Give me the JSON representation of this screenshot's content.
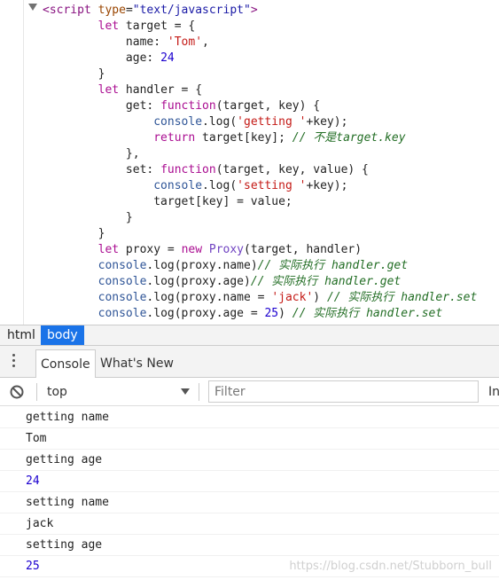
{
  "source": {
    "lines": [
      [
        {
          "t": "<",
          "c": "tag"
        },
        {
          "t": "script",
          "c": "tag"
        },
        {
          "t": " ",
          "c": "plain"
        },
        {
          "t": "type",
          "c": "attr"
        },
        {
          "t": "=",
          "c": "plain"
        },
        {
          "t": "\"text/javascript\"",
          "c": "aval"
        },
        {
          "t": ">",
          "c": "tag"
        }
      ],
      [
        {
          "t": "        ",
          "c": "plain"
        },
        {
          "t": "let",
          "c": "kw"
        },
        {
          "t": " target = {",
          "c": "plain"
        }
      ],
      [
        {
          "t": "            name: ",
          "c": "plain"
        },
        {
          "t": "'Tom'",
          "c": "str"
        },
        {
          "t": ",",
          "c": "plain"
        }
      ],
      [
        {
          "t": "            age: ",
          "c": "plain"
        },
        {
          "t": "24",
          "c": "num"
        }
      ],
      [
        {
          "t": "        }",
          "c": "plain"
        }
      ],
      [
        {
          "t": "        ",
          "c": "plain"
        },
        {
          "t": "let",
          "c": "kw"
        },
        {
          "t": " handler = {",
          "c": "plain"
        }
      ],
      [
        {
          "t": "            get: ",
          "c": "plain"
        },
        {
          "t": "function",
          "c": "kw"
        },
        {
          "t": "(target, key) {",
          "c": "plain"
        }
      ],
      [
        {
          "t": "                ",
          "c": "plain"
        },
        {
          "t": "console",
          "c": "fn"
        },
        {
          "t": ".log(",
          "c": "plain"
        },
        {
          "t": "'getting '",
          "c": "str"
        },
        {
          "t": "+key);",
          "c": "plain"
        }
      ],
      [
        {
          "t": "                ",
          "c": "plain"
        },
        {
          "t": "return",
          "c": "kw"
        },
        {
          "t": " target[key]; ",
          "c": "plain"
        },
        {
          "t": "// 不是target.key",
          "c": "cmt"
        }
      ],
      [
        {
          "t": "            },",
          "c": "plain"
        }
      ],
      [
        {
          "t": "            set: ",
          "c": "plain"
        },
        {
          "t": "function",
          "c": "kw"
        },
        {
          "t": "(target, key, value) {",
          "c": "plain"
        }
      ],
      [
        {
          "t": "                ",
          "c": "plain"
        },
        {
          "t": "console",
          "c": "fn"
        },
        {
          "t": ".log(",
          "c": "plain"
        },
        {
          "t": "'setting '",
          "c": "str"
        },
        {
          "t": "+key);",
          "c": "plain"
        }
      ],
      [
        {
          "t": "                target[key] = value;",
          "c": "plain"
        }
      ],
      [
        {
          "t": "            }",
          "c": "plain"
        }
      ],
      [
        {
          "t": "        }",
          "c": "plain"
        }
      ],
      [
        {
          "t": "        ",
          "c": "plain"
        },
        {
          "t": "let",
          "c": "kw"
        },
        {
          "t": " proxy = ",
          "c": "plain"
        },
        {
          "t": "new",
          "c": "kw"
        },
        {
          "t": " ",
          "c": "plain"
        },
        {
          "t": "Proxy",
          "c": "cls"
        },
        {
          "t": "(target, handler)",
          "c": "plain"
        }
      ],
      [
        {
          "t": "        ",
          "c": "plain"
        },
        {
          "t": "console",
          "c": "fn"
        },
        {
          "t": ".log(proxy.name)",
          "c": "plain"
        },
        {
          "t": "// 实际执行 handler.get",
          "c": "cmt"
        }
      ],
      [
        {
          "t": "        ",
          "c": "plain"
        },
        {
          "t": "console",
          "c": "fn"
        },
        {
          "t": ".log(proxy.age)",
          "c": "plain"
        },
        {
          "t": "// 实际执行 handler.get",
          "c": "cmt"
        }
      ],
      [
        {
          "t": "        ",
          "c": "plain"
        },
        {
          "t": "console",
          "c": "fn"
        },
        {
          "t": ".log(proxy.name = ",
          "c": "plain"
        },
        {
          "t": "'jack'",
          "c": "str"
        },
        {
          "t": ") ",
          "c": "plain"
        },
        {
          "t": "// 实际执行 handler.set",
          "c": "cmt"
        }
      ],
      [
        {
          "t": "        ",
          "c": "plain"
        },
        {
          "t": "console",
          "c": "fn"
        },
        {
          "t": ".log(proxy.age = ",
          "c": "plain"
        },
        {
          "t": "25",
          "c": "num"
        },
        {
          "t": ") ",
          "c": "plain"
        },
        {
          "t": "// 实际执行 handler.set",
          "c": "cmt"
        }
      ]
    ]
  },
  "breadcrumb": {
    "items": [
      {
        "label": "html"
      },
      {
        "label": "body"
      }
    ]
  },
  "drawer": {
    "tabs": [
      {
        "label": "Console"
      },
      {
        "label": "What's New"
      }
    ]
  },
  "toolbar": {
    "context": "top",
    "filter_placeholder": "Filter",
    "levels_label": "In"
  },
  "console": {
    "messages": [
      {
        "text": "getting name",
        "kind": "string"
      },
      {
        "text": "Tom",
        "kind": "string"
      },
      {
        "text": "getting age",
        "kind": "string"
      },
      {
        "text": "24",
        "kind": "number"
      },
      {
        "text": "setting name",
        "kind": "string"
      },
      {
        "text": "jack",
        "kind": "string"
      },
      {
        "text": "setting age",
        "kind": "string"
      },
      {
        "text": "25",
        "kind": "number"
      }
    ]
  },
  "watermark": "https://blog.csdn.net/Stubborn_bull"
}
